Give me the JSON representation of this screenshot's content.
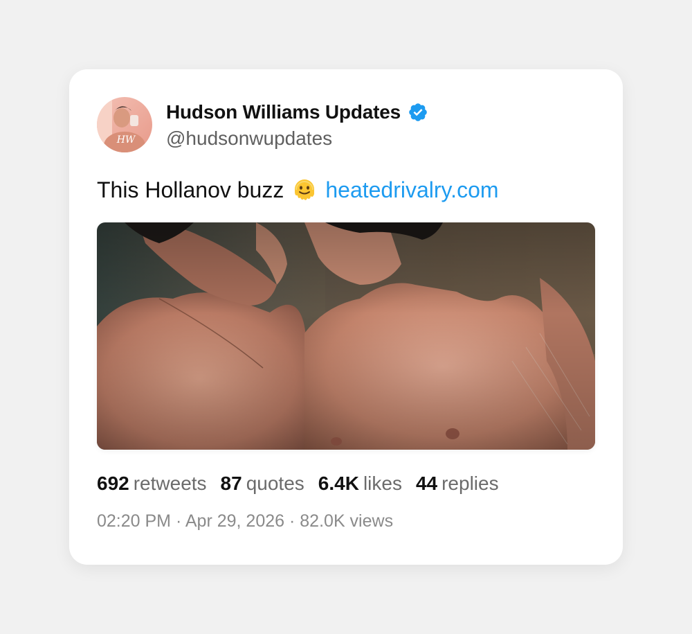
{
  "author": {
    "display_name": "Hudson Williams Updates",
    "handle": "@hudsonwupdates",
    "verified": true,
    "avatar_monogram": "HW",
    "verified_color": "#1d9bf0"
  },
  "tweet": {
    "text": "This Hollanov buzz",
    "emoji": "melting-face-emoji",
    "link_text": "heatedrivalry.com",
    "link_color": "#1d9bf0"
  },
  "stats": {
    "retweets": {
      "value": "692",
      "label": "retweets"
    },
    "quotes": {
      "value": "87",
      "label": "quotes"
    },
    "likes": {
      "value": "6.4K",
      "label": "likes"
    },
    "replies": {
      "value": "44",
      "label": "replies"
    }
  },
  "meta": {
    "time": "02:20 PM",
    "date": "Apr 29, 2026",
    "views": "82.0K views",
    "separator": "·"
  }
}
